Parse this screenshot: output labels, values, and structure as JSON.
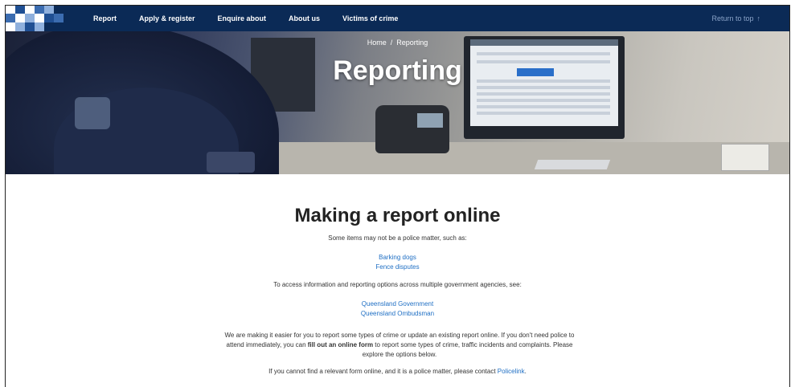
{
  "nav": {
    "items": [
      "Report",
      "Apply & register",
      "Enquire about",
      "About us",
      "Victims of crime"
    ],
    "return_to_top": "Return to top",
    "return_arrow": "↑"
  },
  "hero": {
    "breadcrumb": {
      "home": "Home",
      "separator": "/",
      "current": "Reporting"
    },
    "title": "Reporting"
  },
  "main": {
    "heading": "Making a report online",
    "intro": "Some items may not be a police matter, such as:",
    "links_1": [
      "Barking dogs",
      "Fence disputes"
    ],
    "access_text": "To access information and reporting options across multiple government agencies, see:",
    "links_2": [
      "Queensland Government",
      "Queensland Ombudsman"
    ],
    "para": {
      "part1": "We are making it easier for you to report some types of crime or update an existing report online. If you don't need police to attend immediately, you can ",
      "bold1": "fill out an online form",
      "part2": " to report some types of crime, traffic incidents and complaints. Please explore the options below."
    },
    "contact": {
      "text": "If you cannot find a relevant form online, and it is a police matter, please contact ",
      "link": "Policelink",
      "end": "."
    }
  },
  "colors": {
    "nav_bg": "#0b2a56",
    "link": "#1f6fc4",
    "return_to_top": "#8aa3c8"
  }
}
